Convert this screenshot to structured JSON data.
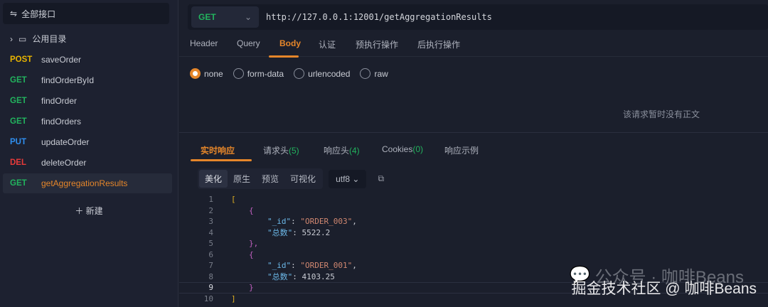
{
  "sidebar": {
    "all_label": "全部接口",
    "folder": "公用目录",
    "items": [
      {
        "method": "POST",
        "name": "saveOrder",
        "color": "#e8b400"
      },
      {
        "method": "GET",
        "name": "findOrderById",
        "color": "#22b35e"
      },
      {
        "method": "GET",
        "name": "findOrder",
        "color": "#22b35e"
      },
      {
        "method": "GET",
        "name": "findOrders",
        "color": "#22b35e"
      },
      {
        "method": "PUT",
        "name": "updateOrder",
        "color": "#2f8ff0"
      },
      {
        "method": "DEL",
        "name": "deleteOrder",
        "color": "#e83a3a"
      },
      {
        "method": "GET",
        "name": "getAggregationResults",
        "color": "#22b35e"
      }
    ],
    "new_label": "新建"
  },
  "request": {
    "method": "GET",
    "url": "http://127.0.0.1:12001/getAggregationResults"
  },
  "tabs": [
    "Header",
    "Query",
    "Body",
    "认证",
    "预执行操作",
    "后执行操作"
  ],
  "body_types": [
    "none",
    "form-data",
    "urlencoded",
    "raw"
  ],
  "no_body": "该请求暂时没有正文",
  "response_tabs": [
    {
      "label": "实时响应",
      "count": ""
    },
    {
      "label": "请求头",
      "count": "(5)"
    },
    {
      "label": "响应头",
      "count": "(4)"
    },
    {
      "label": "Cookies",
      "count": "(0)"
    },
    {
      "label": "响应示例",
      "count": ""
    }
  ],
  "views": [
    "美化",
    "原生",
    "预览",
    "可视化"
  ],
  "encoding": "utf8",
  "code": {
    "lines": [
      "1",
      "2",
      "3",
      "4",
      "5",
      "6",
      "7",
      "8",
      "9",
      "10"
    ],
    "open_bracket": "[",
    "close_bracket": "]",
    "open_brace": "{",
    "close_brace": "}",
    "close_brace_comma": "},",
    "records": [
      {
        "id_key": "\"_id\"",
        "id_val": "\"ORDER_003\"",
        "total_key": "\"总数\"",
        "total_val": "5522.2"
      },
      {
        "id_key": "\"_id\"",
        "id_val": "\"ORDER_001\"",
        "total_key": "\"总数\"",
        "total_val": "4103.25"
      }
    ]
  },
  "watermark": {
    "line1": "公众号 · 咖啡Beans",
    "line2": "掘金技术社区 @ 咖啡Beans"
  }
}
